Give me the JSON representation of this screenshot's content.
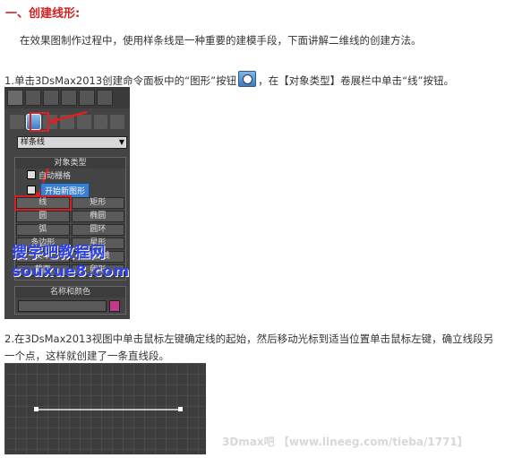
{
  "heading": "一、创建线形:",
  "intro": "在效果图制作过程中，使用样条线是一种重要的建模手段，下面讲解二维线的创建方法。",
  "step1": {
    "before": "1.单击3DsMax2013创建命令面板中的“图形”按钮",
    "after": "，在【对象类型】卷展栏中单击“线”按钮。"
  },
  "panel": {
    "dropdown_value": "样条线",
    "object_type_title": "对象类型",
    "auto_grid": "自动栅格",
    "start_new_shape": "开始新图形",
    "buttons": [
      "线",
      "矩形",
      "圆",
      "椭圆",
      "弧",
      "圆环",
      "多边形",
      "星形",
      "文本",
      "螺旋线",
      "截面",
      "卵形"
    ],
    "name_color_title": "名称和颜色",
    "color_swatch": "#c23a8a"
  },
  "watermark": {
    "line1": "搜学吧教程网",
    "line2": "souxue8.com"
  },
  "step2": "2.在3DsMax2013视图中单击鼠标左键确定线的起始，然后移动光标到适当位置单击鼠标左键，确立线段另一个点，这样就创建了一条直线段。",
  "footer_watermark": "3Dmax吧 【www.lineeg.com/tieba/1771】",
  "accent_red": "#e02020"
}
